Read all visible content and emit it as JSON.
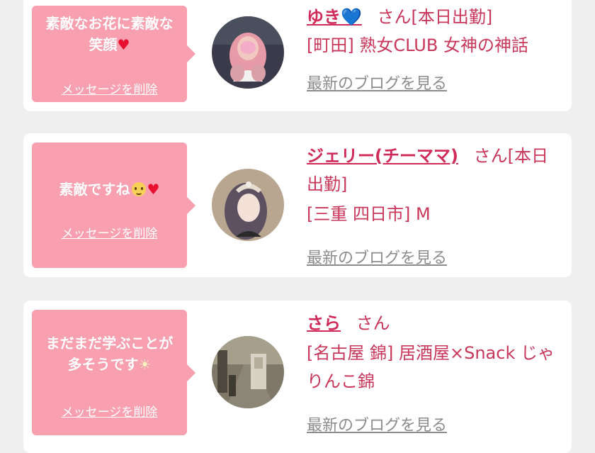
{
  "messages": [
    {
      "bubble_text": "素敵なお花に素敵な笑顔",
      "bubble_emoji": "♥",
      "delete_label": "メッセージを削除",
      "name": "ゆき",
      "name_emoji": "💙",
      "suffix": "さん[本日出勤]",
      "shop": "[町田] 熟女CLUB 女神の神話",
      "blog_label": "最新のブログを見る"
    },
    {
      "bubble_text": "素敵ですね",
      "bubble_emoji": "♥",
      "delete_label": "メッセージを削除",
      "name": "ジェリー(チーママ)",
      "suffix": "さん[本日出勤]",
      "shop": "[三重 四日市] M",
      "blog_label": "最新のブログを見る"
    },
    {
      "bubble_text": "まだまだ学ぶことが多そうです",
      "bubble_emoji": "☀",
      "delete_label": "メッセージを削除",
      "name": "さら",
      "suffix": "さん",
      "shop": "[名古屋 錦] 居酒屋×Snack じゃりんこ錦",
      "blog_label": "最新のブログを見る"
    }
  ],
  "colors": {
    "bubble": "#f9a0b0",
    "name": "#d02b58",
    "text": "#c8375a",
    "link_gray": "#8c8c8c",
    "background": "#efefef"
  }
}
